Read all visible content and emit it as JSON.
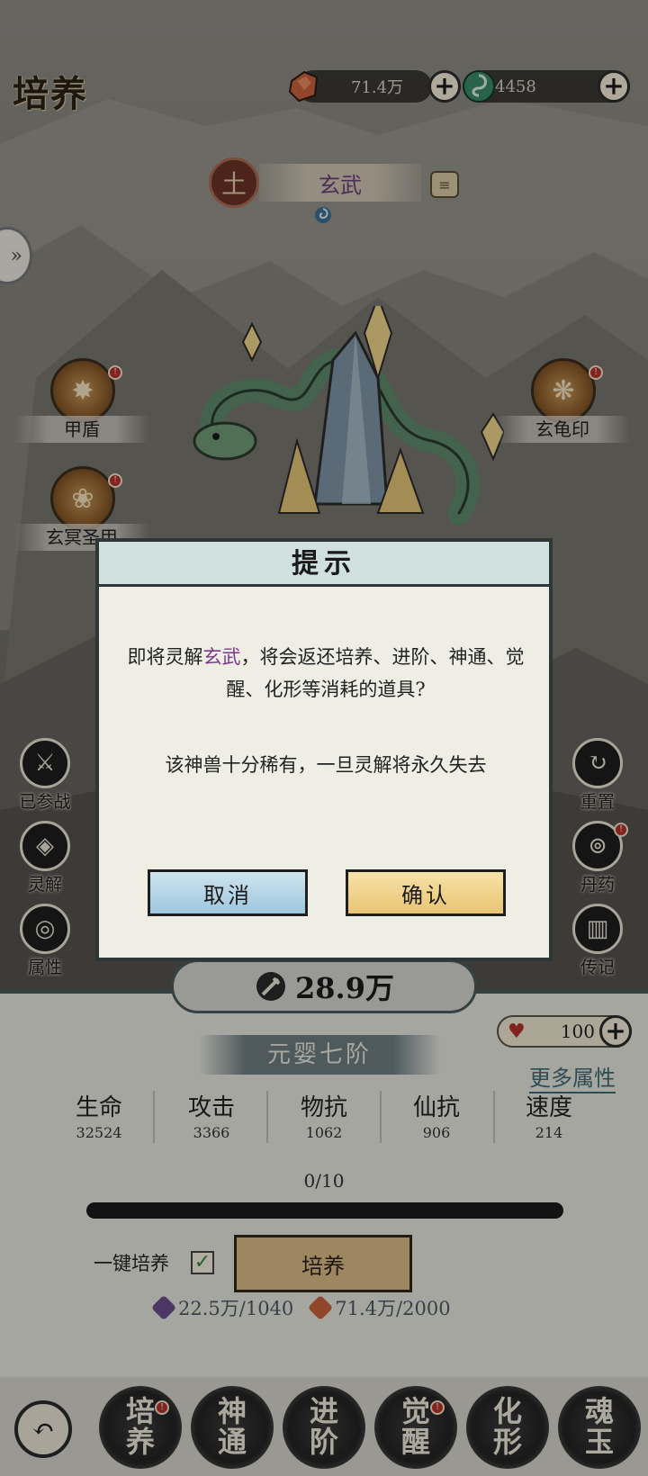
{
  "header": {
    "title": "培养",
    "currency1": {
      "value": "71.4万",
      "icon": "ore-icon",
      "color": "#c8613b"
    },
    "currency2": {
      "value": "4458",
      "icon": "jade-swirl-icon",
      "color": "#3a8a68"
    }
  },
  "beast": {
    "name": "玄武",
    "element": "土",
    "skills": [
      {
        "label": "甲盾"
      },
      {
        "label": "玄龟印"
      },
      {
        "label": "玄冥圣甲"
      }
    ]
  },
  "left_menu": [
    {
      "label": "已参战"
    },
    {
      "label": "灵解"
    },
    {
      "label": "属性"
    }
  ],
  "right_menu": [
    {
      "label": "重置"
    },
    {
      "label": "丹药"
    },
    {
      "label": "传记"
    }
  ],
  "dialog": {
    "title": "提示",
    "message_pre": "即将灵解",
    "message_highlight": "玄武",
    "message_post": "，将会返还培养、进阶、神通、觉醒、化形等消耗的道具?",
    "warning": "该神兽十分稀有，一旦灵解将永久失去",
    "cancel": "取消",
    "confirm": "确认"
  },
  "panel": {
    "power": "28.9万",
    "realm": "元婴七阶",
    "hp_value": "100",
    "more_attributes": "更多属性",
    "stats": [
      {
        "name": "生命",
        "value": "32524"
      },
      {
        "name": "攻击",
        "value": "3366"
      },
      {
        "name": "物抗",
        "value": "1062"
      },
      {
        "name": "仙抗",
        "value": "906"
      },
      {
        "name": "速度",
        "value": "214"
      }
    ],
    "progress_text": "0/10",
    "progress_fraction": 0,
    "one_click_label": "一键培养",
    "one_click_checked": true,
    "cultivate_button": "培养",
    "cost1": "22.5万/1040",
    "cost2": "71.4万/2000"
  },
  "tabs": [
    {
      "line1": "培",
      "line2": "养"
    },
    {
      "line1": "神",
      "line2": "通"
    },
    {
      "line1": "进",
      "line2": "阶"
    },
    {
      "line1": "觉",
      "line2": "醒"
    },
    {
      "line1": "化",
      "line2": "形"
    },
    {
      "line1": "魂",
      "line2": "玉"
    }
  ]
}
